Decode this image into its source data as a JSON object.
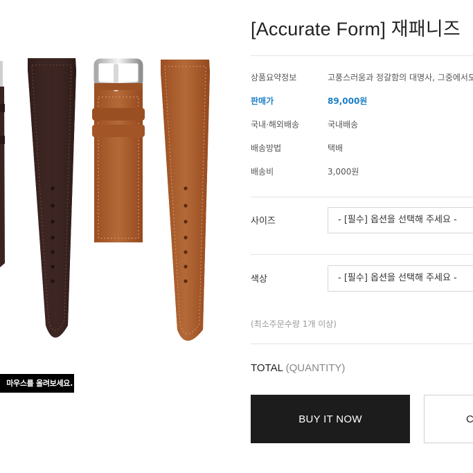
{
  "product": {
    "title": "[Accurate Form] 재패니즈",
    "image_tip": "마우스를 올려보세요."
  },
  "specs": {
    "summary_label": "상품요약정보",
    "summary_value": "고풍스러움과 정갈함의 대명사, 그중에서도",
    "price_label": "판매가",
    "price_value": "89,000원",
    "shipping_scope_label": "국내·해외배송",
    "shipping_scope_value": "국내배송",
    "shipping_method_label": "배송방법",
    "shipping_method_value": "택배",
    "shipping_fee_label": "배송비",
    "shipping_fee_value": "3,000원"
  },
  "options": {
    "size_label": "사이즈",
    "size_selected": "- [필수] 옵션을 선택해 주세요 -",
    "color_label": "색상",
    "color_selected": "- [필수] 옵션을 선택해 주세요 -"
  },
  "min_qty_note": "(최소주문수량 1개 이상)",
  "total": {
    "label": "TOTAL",
    "qty_label": "(QUANTITY)"
  },
  "buttons": {
    "buy_now": "BUY IT NOW",
    "cart": "CART"
  },
  "colors": {
    "price_accent": "#1d7fc6",
    "buy_button_bg": "#1c1c1c",
    "strap_dark": "#3a2421",
    "strap_tan": "#a55a2c"
  }
}
